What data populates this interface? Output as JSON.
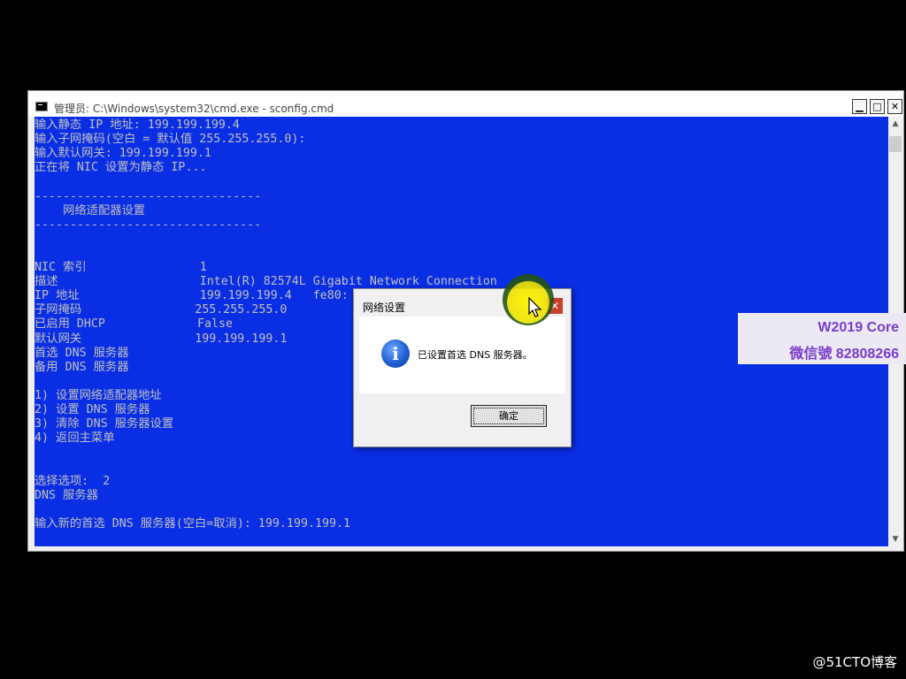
{
  "window": {
    "title": "管理员: C:\\Windows\\system32\\cmd.exe - sconfig.cmd",
    "minimize": "▁",
    "maximize": "□",
    "close": "✕"
  },
  "console": {
    "lines": [
      "输入静态 IP 地址: 199.199.199.4",
      "输入子网掩码(空白 = 默认值 255.255.255.0):",
      "输入默认网关: 199.199.199.1",
      "正在将 NIC 设置为静态 IP...",
      "",
      "--------------------------------",
      "    网络适配器设置",
      "--------------------------------",
      "",
      "",
      "NIC 索引                1",
      "描述                    Intel(R) 82574L Gigabit Network Connection",
      "IP 地址                 199.199.199.4   fe80:",
      "子网掩码                255.255.255.0",
      "已启用 DHCP             False",
      "默认网关                199.199.199.1",
      "首选 DNS 服务器",
      "备用 DNS 服务器",
      "",
      "1) 设置网络适配器地址",
      "2) 设置 DNS 服务器",
      "3) 清除 DNS 服务器设置",
      "4) 返回主菜单",
      "",
      "",
      "选择选项:  2",
      "DNS 服务器",
      "",
      "输入新的首选 DNS 服务器(空白=取消): 199.199.199.1"
    ]
  },
  "dialog": {
    "title": "网络设置",
    "close": "✕",
    "message": "已设置首选 DNS 服务器。",
    "icon": "information-icon",
    "ok_label": "确定"
  },
  "watermark": {
    "line1": "W2019 Core",
    "line2": "微信號 82808266",
    "site": "@51CTO博客"
  },
  "colors": {
    "console_bg": "#0a2ee3",
    "console_text": "#c0c0c0",
    "dialog_close": "#c8412f",
    "watermark_text": "#7a3cc9"
  }
}
